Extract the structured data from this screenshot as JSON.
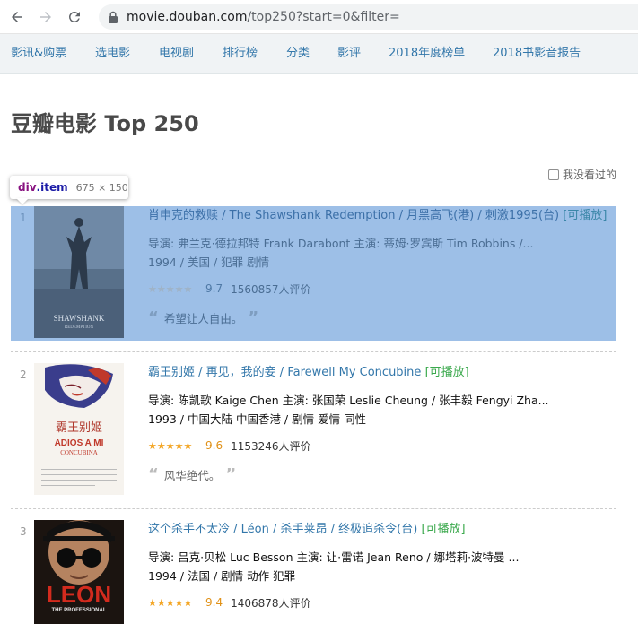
{
  "browser": {
    "url_host": "movie.douban.com",
    "url_path": "/top250?start=0&filter="
  },
  "subnav": {
    "items": [
      {
        "label": "影讯&购票"
      },
      {
        "label": "选电影"
      },
      {
        "label": "电视剧"
      },
      {
        "label": "排行榜"
      },
      {
        "label": "分类"
      },
      {
        "label": "影评"
      },
      {
        "label": "2018年度榜单"
      },
      {
        "label": "2018书影音报告"
      }
    ]
  },
  "page": {
    "title": "豆瓣电影 Top 250",
    "filter_label": "我没看过的"
  },
  "devtools_tooltip": {
    "tag": "div",
    "cls": ".item",
    "dims": "675 × 150"
  },
  "movies": [
    {
      "rank": "1",
      "title": "肖申克的救赎",
      "alt_title": " / The Shawshank Redemption",
      "other_title": " / 月黑高飞(港) / 刺激1995(台)",
      "playable": "[可播放]",
      "director_line": "导演: 弗兰克·德拉邦特 Frank Darabont   主演: 蒂姆·罗宾斯 Tim Robbins /...",
      "meta_line": "1994 / 美国 / 犯罪 剧情",
      "rating": "9.7",
      "rating_fraction": 0.97,
      "votes": "1560857人评价",
      "quote": "希望让人自由。"
    },
    {
      "rank": "2",
      "title": "霸王别姬",
      "alt_title": " / 再见，我的妾",
      "other_title": " / Farewell My Concubine",
      "playable": "[可播放]",
      "director_line": "导演: 陈凯歌 Kaige Chen   主演: 张国荣 Leslie Cheung / 张丰毅 Fengyi Zha...",
      "meta_line": "1993 / 中国大陆 中国香港 / 剧情 爱情 同性",
      "rating": "9.6",
      "rating_fraction": 0.96,
      "votes": "1153246人评价",
      "quote": "风华绝代。"
    },
    {
      "rank": "3",
      "title": "这个杀手不太冷",
      "alt_title": " / Léon",
      "other_title": " / 杀手莱昂 / 终极追杀令(台)",
      "playable": "[可播放]",
      "director_line": "导演: 吕克·贝松 Luc Besson   主演: 让·雷诺 Jean Reno / 娜塔莉·波特曼 ...",
      "meta_line": "1994 / 法国 / 剧情 动作 犯罪",
      "rating": "9.4",
      "rating_fraction": 0.9,
      "votes": "1406878人评价",
      "quote": ""
    }
  ],
  "posters": {
    "p1_title": "SHAWSHANK",
    "p1_sub": "REDEMPTION",
    "p2_cn": "霸王别姬",
    "p2_en": "ADIOS A MI",
    "p2_sub": "CONCUBINA",
    "p3_title": "LEON",
    "p3_sub": "THE PROFESSIONAL"
  },
  "colors": {
    "link": "#3377aa",
    "playable": "#3ba94d",
    "star": "#f5a623",
    "highlight": "#6fa0dc"
  }
}
